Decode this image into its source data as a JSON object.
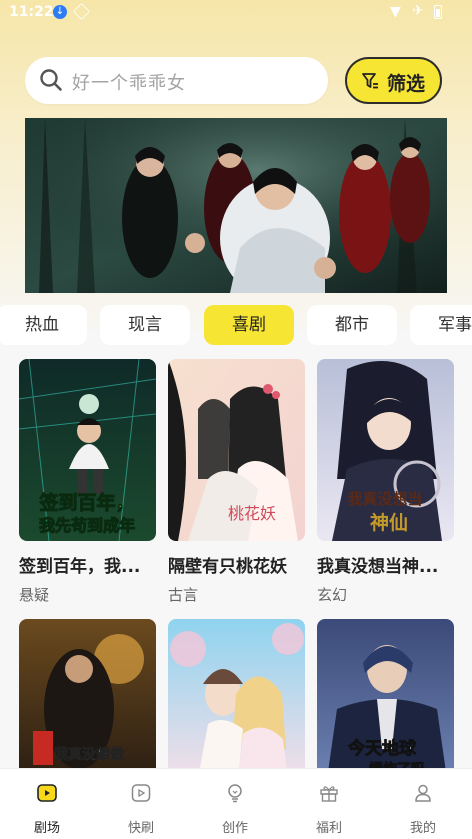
{
  "status_bar": {
    "time": "11:22"
  },
  "search": {
    "placeholder": "好一个乖乖女"
  },
  "filter_button": {
    "label": "筛选"
  },
  "category_tabs": [
    {
      "label": "热血"
    },
    {
      "label": "现言"
    },
    {
      "label": "喜剧",
      "active": true
    },
    {
      "label": "都市"
    },
    {
      "label": "军事"
    }
  ],
  "cards": [
    {
      "title": "签到百年，我...",
      "genre": "悬疑",
      "cover_text": "签到百年，我先苟到成年"
    },
    {
      "title": "隔壁有只桃花妖",
      "genre": "古言",
      "cover_text": "桃花妖"
    },
    {
      "title": "我真没想当神...",
      "genre": "玄幻",
      "cover_text": "我真没想当神仙"
    },
    {
      "title": "",
      "genre": "",
      "cover_text": "我真没想做大佬"
    },
    {
      "title": "",
      "genre": "",
      "cover_text": ""
    },
    {
      "title": "",
      "genre": "",
      "cover_text": "今天地球爆炸了吗"
    }
  ],
  "bottom_nav": [
    {
      "label": "剧场",
      "icon": "theater-icon",
      "active": true
    },
    {
      "label": "快刷",
      "icon": "play-icon"
    },
    {
      "label": "创作",
      "icon": "bulb-icon"
    },
    {
      "label": "福利",
      "icon": "gift-icon"
    },
    {
      "label": "我的",
      "icon": "user-icon"
    }
  ],
  "colors": {
    "accent": "#f7e534",
    "text": "#222222"
  }
}
